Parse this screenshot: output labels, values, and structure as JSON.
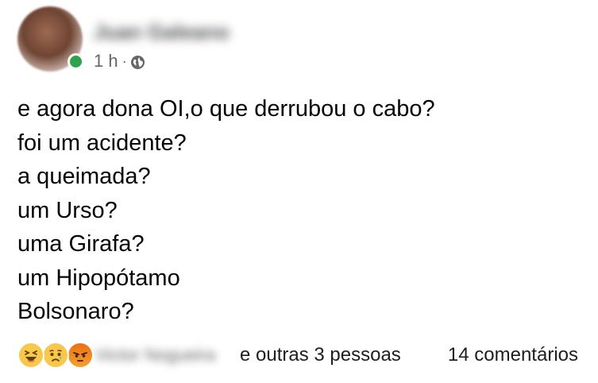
{
  "post": {
    "author_name": "Juan Galeano",
    "time": "1 h",
    "separator": "·",
    "privacy_icon": "globe-icon",
    "lines": [
      "e agora dona OI,o que derrubou o cabo?",
      "foi um acidente?",
      "a queimada?",
      "um Urso?",
      "uma Girafa?",
      "um Hipopótamo",
      "Bolsonaro?"
    ]
  },
  "footer": {
    "reaction_icons": [
      "haha-reaction-icon",
      "sad-reaction-icon",
      "angry-reaction-icon"
    ],
    "reactor_name": "Victor Nogueira",
    "others_text": "e outras 3 pessoas",
    "comments_text": "14 comentários"
  },
  "colors": {
    "online": "#31a24c",
    "secondary_text": "#65676b",
    "primary_text": "#050505",
    "reaction_yellow": "#f7c84b",
    "reaction_angry": "#e9710f"
  }
}
